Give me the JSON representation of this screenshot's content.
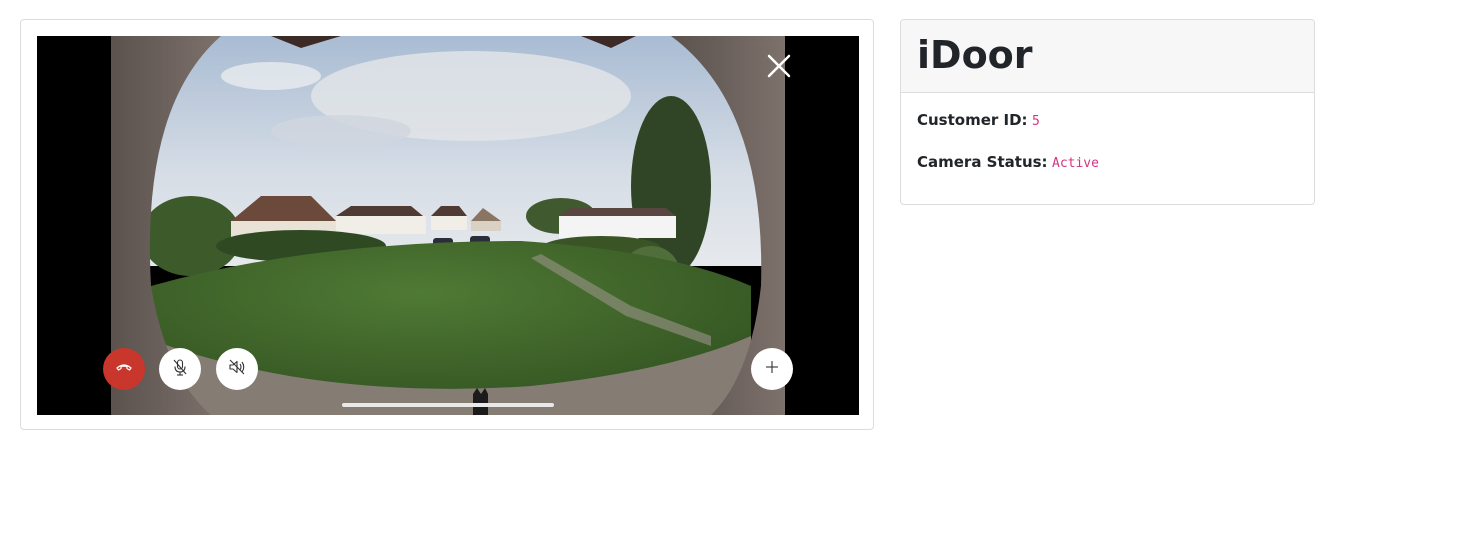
{
  "info": {
    "title": "iDoor",
    "customer_id_label": "Customer ID:",
    "customer_id_value": "5",
    "camera_status_label": "Camera Status:",
    "camera_status_value": "Active"
  },
  "call_controls": {
    "end_call_icon": "phone-hangup-icon",
    "mute_icon": "microphone-off-icon",
    "speaker_icon": "speaker-off-icon",
    "add_icon": "plus-icon",
    "close_icon": "close-icon"
  },
  "colors": {
    "end_call": "#c9362b",
    "value_text": "#d63384"
  }
}
